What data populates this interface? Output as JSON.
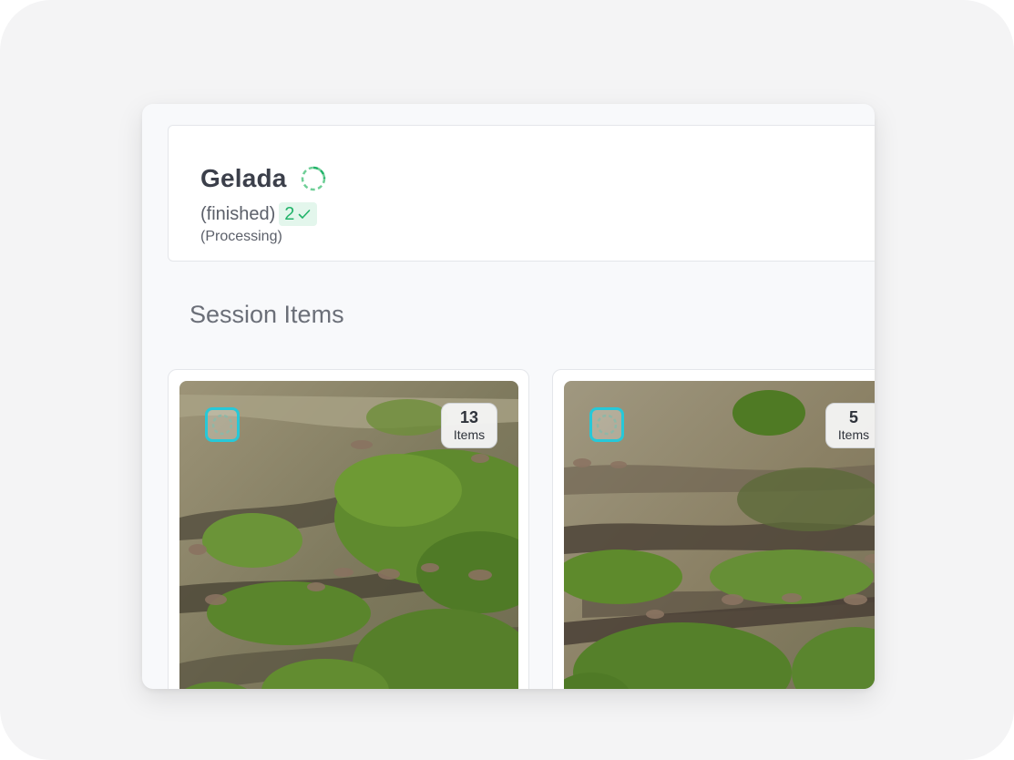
{
  "session": {
    "title": "Gelada",
    "status_label": "(finished)",
    "finished_count": "2",
    "processing_label": "(Processing)"
  },
  "section": {
    "title": "Session Items"
  },
  "items": [
    {
      "count": "13",
      "count_label": "Items",
      "status_icon": "loading-spinner-icon"
    },
    {
      "count": "5",
      "count_label": "Items",
      "status_icon": "loading-spinner-icon"
    }
  ],
  "colors": {
    "accent_green": "#22b36a",
    "badge_bg": "#e3f6ec",
    "spinner_cyan": "#27c8d8"
  }
}
